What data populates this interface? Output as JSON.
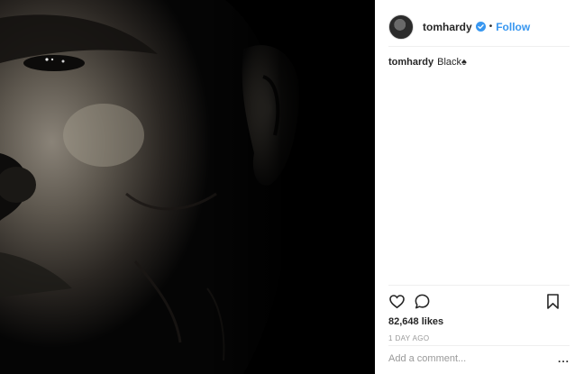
{
  "post": {
    "image_alt_icon": "portrait-photo"
  },
  "header": {
    "username": "tomhardy",
    "separator": "•",
    "follow_label": "Follow"
  },
  "caption": {
    "username": "tomhardy",
    "text": "Black♠"
  },
  "actions": {
    "like_icon": "heart-icon",
    "comment_icon": "comment-icon",
    "save_icon": "bookmark-icon"
  },
  "stats": {
    "likes": "82,648 likes",
    "timestamp": "1 DAY AGO"
  },
  "comment": {
    "placeholder": "Add a comment...",
    "more_label": "..."
  },
  "colors": {
    "link": "#3897f0",
    "text": "#262626",
    "muted": "#999999",
    "divider": "#efefef"
  }
}
